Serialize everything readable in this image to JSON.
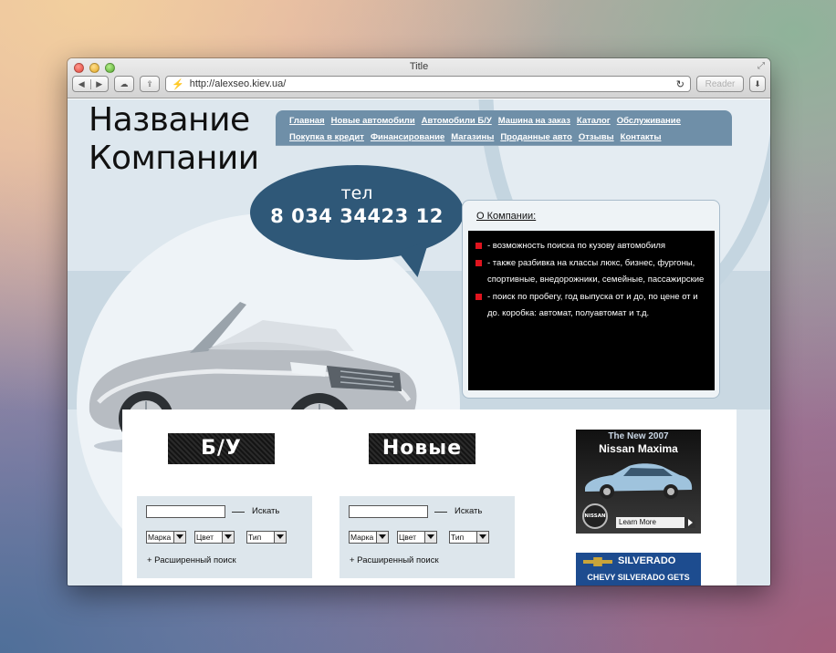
{
  "window": {
    "title": "Title",
    "url": "http://alexseo.kiev.ua/",
    "reader_label": "Reader"
  },
  "site": {
    "company_line1": "Название",
    "company_line2": "Компании",
    "nav_row1": [
      "Главная",
      "Новые автомобили",
      "Автомобили Б/У",
      "Машина на заказ",
      "Каталог",
      "Обслуживание"
    ],
    "nav_row2": [
      "Покупка в кредит",
      "Финансирование",
      "Магазины",
      "Проданные авто",
      "Отзывы",
      "Контакты"
    ],
    "phone_label": "тел",
    "phone_number": "8 034 34423 12",
    "about_title": "О Компании:",
    "about_items": [
      "- возможность поиска по кузову автомобиля",
      "- также разбивка на классы люкс, бизнес, фургоны, спортивные, внедорожники, семейные, пассажирские",
      "- поиск по пробегу, год выпуска от и до, по цене от и до. коробка: автомат, полуавтомат и т.д."
    ]
  },
  "sections": {
    "used_label": "Б/У",
    "new_label": "Новые"
  },
  "search": {
    "button_label": "Искать",
    "brand_label": "Марка",
    "color_label": "Цвет",
    "type_label": "Тип",
    "advanced_label": "+ Расширенный поиск"
  },
  "ads": {
    "nissan_line1": "The New 2007",
    "nissan_line2": "Nissan Maxima",
    "nissan_logo": "NISSAN",
    "nissan_cta": "Learn More",
    "chevy_title": "SILVERADO",
    "chevy_sub": "CHEVY SILVERADO GETS"
  }
}
